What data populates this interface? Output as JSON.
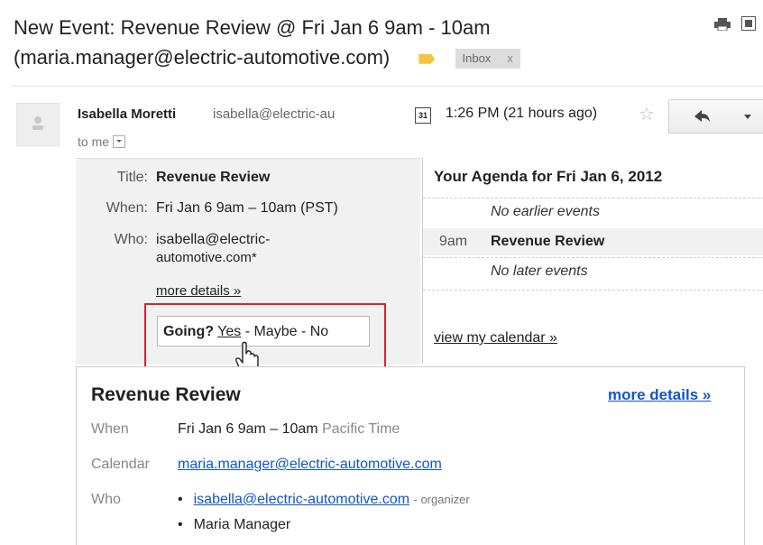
{
  "subject": {
    "line1": "New Event: Revenue Review @ Fri Jan 6 9am - 10am",
    "line2": "(maria.manager@electric-automotive.com)",
    "label": "Inbox",
    "label_close": "x"
  },
  "sender": {
    "name": "Isabella Moretti",
    "email": "isabella@electric-au",
    "to": "to me",
    "calendar_icon_text": "31",
    "time": "1:26 PM (21 hours ago)",
    "star": "☆"
  },
  "invite": {
    "title_label": "Title:",
    "title_value": "Revenue Review",
    "when_label": "When:",
    "when_value": "Fri Jan 6 9am – 10am (PST)",
    "who_label": "Who:",
    "who_value_line1": "isabella@electric-",
    "who_value_line2": "automotive.com*",
    "more_details": "more details »",
    "going_label": "Going?",
    "yes": "Yes",
    "sep1": " - ",
    "maybe": "Maybe",
    "sep2": " - ",
    "no": "No"
  },
  "agenda": {
    "title": "Your Agenda for Fri Jan 6, 2012",
    "no_earlier": "No earlier events",
    "event_time": "9am",
    "event_title": "Revenue Review",
    "no_later": "No later events",
    "view_calendar": "view my calendar »"
  },
  "details": {
    "title": "Revenue Review",
    "more_details": "more details »",
    "when_label": "When",
    "when_value": "Fri Jan 6 9am – 10am",
    "when_tz": "Pacific Time",
    "calendar_label": "Calendar",
    "calendar_value": "maria.manager@electric-automotive.com",
    "who_label": "Who",
    "who_1": "isabella@electric-automotive.com",
    "who_1_role": "- organizer",
    "who_2": "Maria Manager"
  },
  "colors": {
    "highlight": "#d9232e",
    "link": "#1155cc",
    "label_tag": "#f5c542"
  }
}
